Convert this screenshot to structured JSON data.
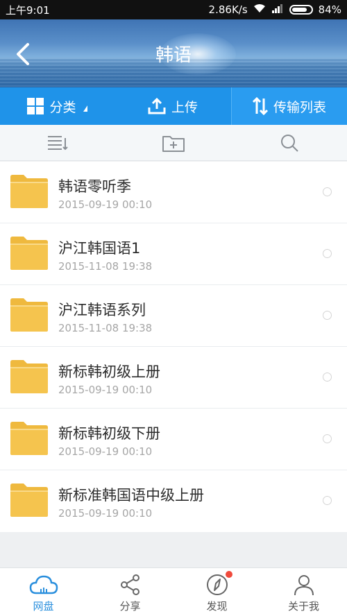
{
  "status_bar": {
    "time": "上午9:01",
    "speed": "2.86K/s",
    "battery": "84%",
    "battery_level": 0.84,
    "icons": [
      "wifi-icon",
      "signal-icon",
      "battery-icon"
    ]
  },
  "header": {
    "title": "韩语",
    "back_icon": "chevron-left-icon"
  },
  "action_bar": {
    "category_label": "分类",
    "upload_label": "上传",
    "transfer_label": "传输列表",
    "icons": [
      "grid-icon",
      "upload-icon",
      "transfer-icon"
    ]
  },
  "toolbar": {
    "icons": [
      "sort-icon",
      "new-folder-icon",
      "search-icon"
    ]
  },
  "files": [
    {
      "name": "韩语零听季",
      "date": "2015-09-19  00:10"
    },
    {
      "name": "沪江韩国语1",
      "date": "2015-11-08  19:38"
    },
    {
      "name": "沪江韩语系列",
      "date": "2015-11-08  19:38"
    },
    {
      "name": "新标韩初级上册",
      "date": "2015-09-19  00:10"
    },
    {
      "name": "新标韩初级下册",
      "date": "2015-09-19  00:10"
    },
    {
      "name": "新标准韩国语中级上册",
      "date": "2015-09-19  00:10"
    }
  ],
  "bottom_nav": {
    "items": [
      {
        "label": "网盘",
        "icon": "cloud-icon",
        "active": true
      },
      {
        "label": "分享",
        "icon": "share-icon",
        "active": false
      },
      {
        "label": "发现",
        "icon": "compass-icon",
        "active": false,
        "badge": true
      },
      {
        "label": "关于我",
        "icon": "person-icon",
        "active": false
      }
    ]
  },
  "colors": {
    "accent": "#1f93e9",
    "folder": "#f5c44e",
    "active_nav": "#2a8fdd",
    "badge": "#f04a3c"
  }
}
